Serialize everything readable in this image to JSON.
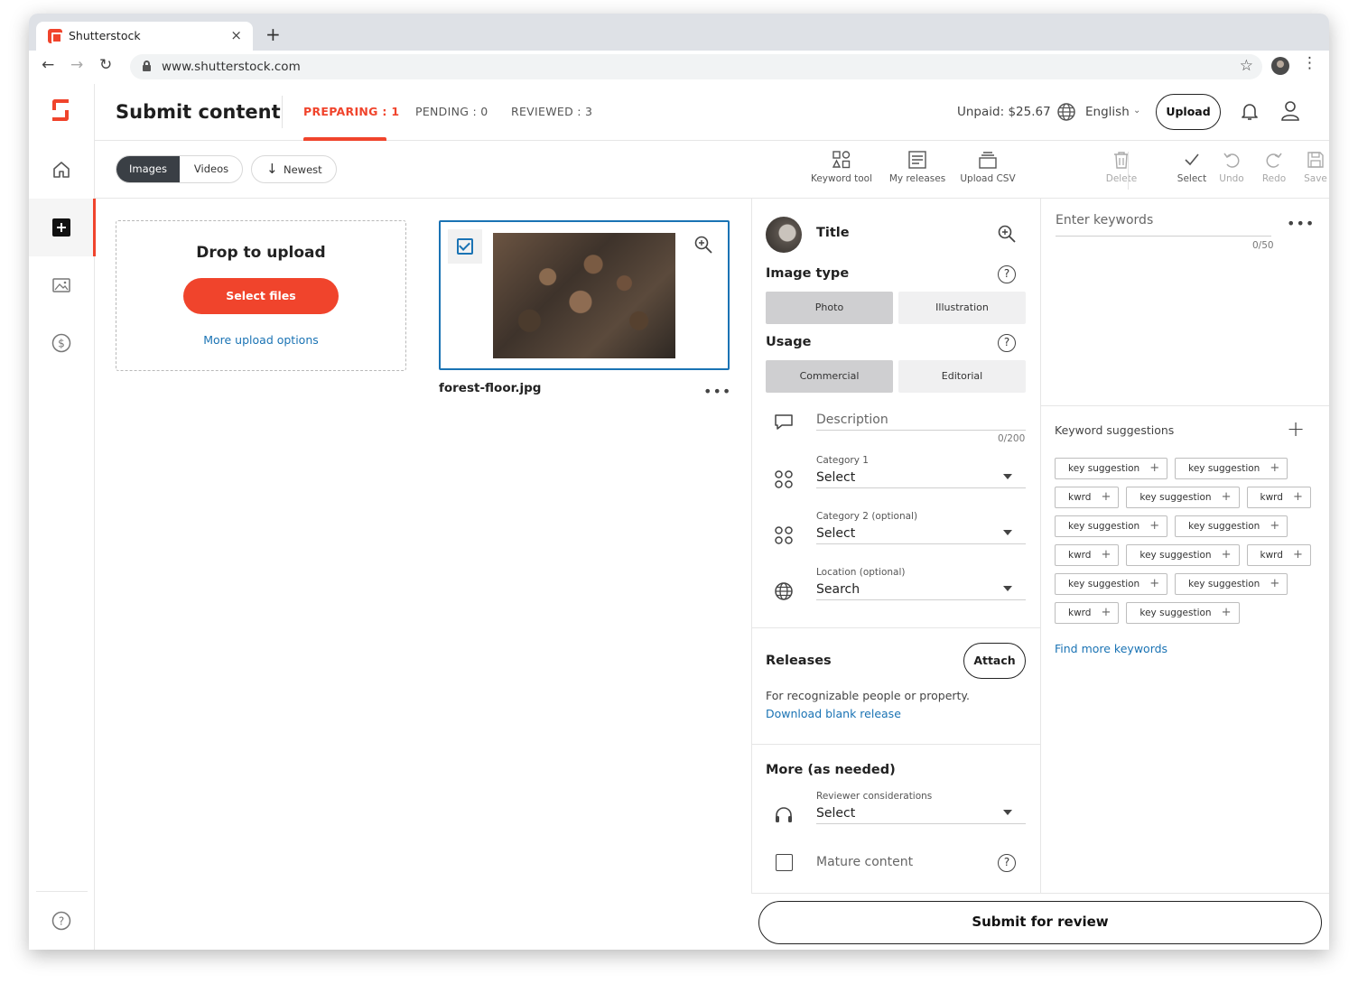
{
  "browser": {
    "tab_title": "Shutterstock",
    "tab_close": "×",
    "new_tab": "+",
    "url": "www.shutterstock.com",
    "back": "←",
    "forward": "→",
    "reload": "↻",
    "bookmark": "☆",
    "menu": "⋮"
  },
  "header": {
    "title": "Submit content",
    "tabs": [
      {
        "label": "PREPARING : 1",
        "active": true
      },
      {
        "label": "PENDING : 0",
        "active": false
      },
      {
        "label": "REVIEWED : 3",
        "active": false
      }
    ],
    "unpaid": "Unpaid: $25.67",
    "language": "English",
    "lang_caret": "⌄",
    "upload_label": "Upload"
  },
  "subbar": {
    "media_toggle": [
      "Images",
      "Videos"
    ],
    "sort_label": "Newest",
    "sort_arrow": "↓",
    "tools": [
      "Keyword tool",
      "My releases",
      "Upload CSV"
    ],
    "actions": [
      "Delete",
      "Select",
      "Undo",
      "Redo",
      "Save"
    ]
  },
  "upload": {
    "title": "Drop to upload",
    "button": "Select files",
    "more": "More upload options"
  },
  "file": {
    "name": "forest-floor.jpg",
    "more": "•••"
  },
  "details": {
    "title": "Title",
    "image_type": {
      "label": "Image type",
      "options": [
        "Photo",
        "Illustration"
      ],
      "selected": "Photo"
    },
    "usage": {
      "label": "Usage",
      "options": [
        "Commercial",
        "Editorial"
      ],
      "selected": "Commercial"
    },
    "description": {
      "placeholder": "Description",
      "counter": "0/200"
    },
    "category1": {
      "label": "Category 1",
      "value": "Select"
    },
    "category2": {
      "label": "Category 2 (optional)",
      "value": "Select"
    },
    "location": {
      "label": "Location (optional)",
      "value": "Search"
    },
    "releases": {
      "title": "Releases",
      "attach": "Attach",
      "text": "For recognizable people or property.",
      "link": "Download blank release"
    },
    "more": {
      "title": "More (as needed)",
      "reviewer_label": "Reviewer considerations",
      "reviewer_value": "Select",
      "mature": "Mature content"
    },
    "help_glyph": "?"
  },
  "keywords": {
    "placeholder": "Enter keywords",
    "counter": "0/50",
    "more": "•••",
    "suggestions_title": "Keyword suggestions",
    "add": "+",
    "chip_plus": "+",
    "rows": [
      [
        "key suggestion",
        "key suggestion"
      ],
      [
        "kwrd",
        "key suggestion",
        "kwrd"
      ],
      [
        "key suggestion",
        "key suggestion"
      ],
      [
        "kwrd",
        "key suggestion",
        "kwrd"
      ],
      [
        "key suggestion",
        "key suggestion"
      ],
      [
        "kwrd",
        "key suggestion"
      ]
    ],
    "find_more": "Find more keywords"
  },
  "submit": "Submit for review",
  "colors": {
    "accent": "#f0442c",
    "link": "#1a73b4",
    "dark": "#3a3f45"
  }
}
